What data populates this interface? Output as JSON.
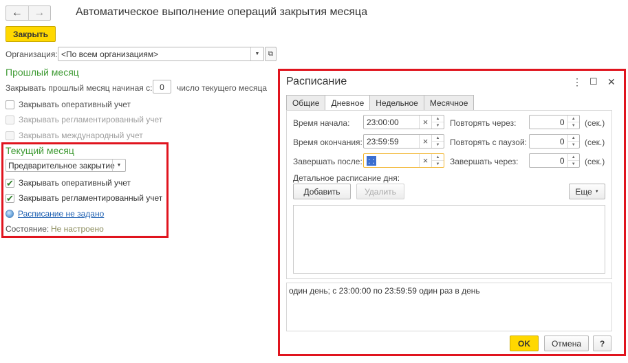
{
  "window": {
    "title": "Автоматическое выполнение операций закрытия месяца",
    "back_glyph": "←",
    "forward_glyph": "→"
  },
  "toolbar": {
    "close_label": "Закрыть"
  },
  "organization": {
    "label": "Организация:",
    "value": "<По всем организациям>"
  },
  "previous_month": {
    "heading": "Прошлый месяц",
    "close_from_label": "Закрывать прошлый месяц начиная с:",
    "close_from_value": "0",
    "close_from_suffix": "число текущего месяца",
    "checkboxes": [
      {
        "label": "Закрывать оперативный учет",
        "checked": false,
        "enabled": true
      },
      {
        "label": "Закрывать регламентированный учет",
        "checked": false,
        "enabled": false
      },
      {
        "label": "Закрывать международный учет",
        "checked": false,
        "enabled": false
      }
    ]
  },
  "current_month": {
    "heading": "Текущий месяц",
    "mode_value": "Предварительное закрытие",
    "checkboxes": [
      {
        "label": "Закрывать оперативный учет",
        "checked": true
      },
      {
        "label": "Закрывать регламентированный учет",
        "checked": true
      }
    ],
    "schedule_link": "Расписание не задано",
    "state_label": "Состояние:",
    "state_value": "Не настроено"
  },
  "dialog": {
    "title": "Расписание",
    "more_glyph": "⋮",
    "maximize_glyph": "☐",
    "close_glyph": "✕",
    "tabs": [
      {
        "label": "Общие",
        "active": false
      },
      {
        "label": "Дневное",
        "active": true
      },
      {
        "label": "Недельное",
        "active": false
      },
      {
        "label": "Месячное",
        "active": false
      }
    ],
    "start_time_label": "Время начала:",
    "start_time_value": "23:00:00",
    "end_time_label": "Время окончания:",
    "end_time_value": "23:59:59",
    "finish_after_label": "Завершать после:",
    "finish_after_value": " : : ",
    "repeat_every_label": "Повторять через:",
    "repeat_every_value": "0",
    "repeat_pause_label": "Повторять с паузой:",
    "repeat_pause_value": "0",
    "finish_in_label": "Завершать через:",
    "finish_in_value": "0",
    "sec_unit": "(сек.)",
    "detail_label": "Детальное расписание дня:",
    "add_button": "Добавить",
    "delete_button": "Удалить",
    "more_button": "Еще",
    "description": "один день; с 23:00:00 по 23:59:59 один раз в день",
    "ok_button": "OK",
    "cancel_button": "Отмена",
    "help_button": "?"
  },
  "colors": {
    "highlight_frame": "#e0141e",
    "accent_yellow": "#ffd800",
    "section_green": "#3f9b34",
    "link_blue": "#1d5fb1"
  }
}
